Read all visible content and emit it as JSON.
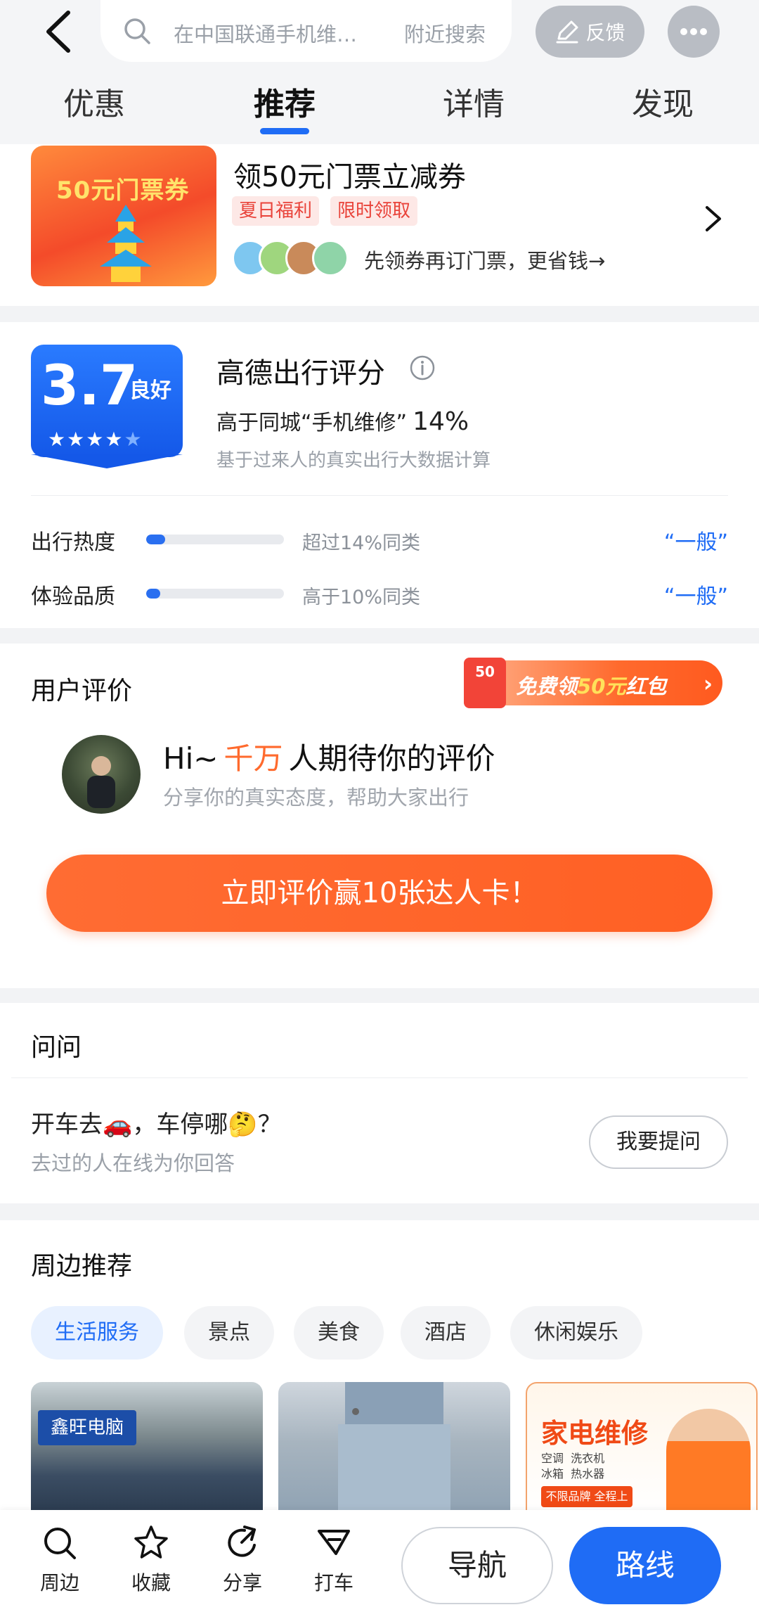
{
  "header": {
    "search_placeholder": "在中国联通手机维…",
    "nearby_search": "附近搜索",
    "feedback": "反馈",
    "tabs": [
      {
        "label": "优惠"
      },
      {
        "label": "推荐"
      },
      {
        "label": "详情"
      },
      {
        "label": "发现"
      }
    ],
    "active_tab": "推荐"
  },
  "coupon": {
    "image_text": "50元门票券",
    "title": "领50元门票立减券",
    "tags": [
      "夏日福利",
      "限时领取"
    ],
    "desc": "先领券再订门票，更省钱→"
  },
  "rating": {
    "score": "3.7",
    "level": "良好",
    "stars": 3.5,
    "title": "高德出行评分",
    "compare": "高于同城“手机维修”",
    "compare_pct": "14%",
    "basis": "基于过来人的真实出行大数据计算",
    "metrics": [
      {
        "label": "出行热度",
        "fill": 0.14,
        "text": "超过14%同类",
        "value": "“一般”"
      },
      {
        "label": "体验品质",
        "fill": 0.1,
        "text": "高于10%同类",
        "value": "“一般”"
      }
    ]
  },
  "reviews": {
    "title": "用户评价",
    "redpacket_icon_text": "50",
    "redpacket_pre": "免费领",
    "redpacket_amount": "50元",
    "redpacket_post": "红包",
    "headline_pre": "Hi~",
    "headline_highlight": "千万",
    "headline_post": "人期待你的评价",
    "sub": "分享你的真实态度，帮助大家出行",
    "cta": "立即评价赢10张达人卡！"
  },
  "qa": {
    "title": "问问",
    "question": "开车去🚗，车停哪🤔？",
    "sub": "去过的人在线为你回答",
    "ask_button": "我要提问"
  },
  "nearby": {
    "title": "周边推荐",
    "chips": [
      "生活服务",
      "景点",
      "美食",
      "酒店",
      "休闲娱乐"
    ],
    "active_chip": "生活服务",
    "thumb1_sign": "鑫旺电脑",
    "thumb3_title": "家电维修",
    "thumb3_items": "空调  洗衣机\n冰箱  热水器",
    "thumb3_bar": "不限品牌 全程上门"
  },
  "bottom": {
    "items": [
      {
        "label": "周边",
        "icon": "search-icon"
      },
      {
        "label": "收藏",
        "icon": "star-icon"
      },
      {
        "label": "分享",
        "icon": "share-icon"
      },
      {
        "label": "打车",
        "icon": "taxi-icon"
      }
    ],
    "nav": "导航",
    "route": "路线"
  },
  "colors": {
    "accent_blue": "#1f6cf5",
    "accent_orange": "#ff6a2d",
    "tag_red": "#e9433a"
  }
}
